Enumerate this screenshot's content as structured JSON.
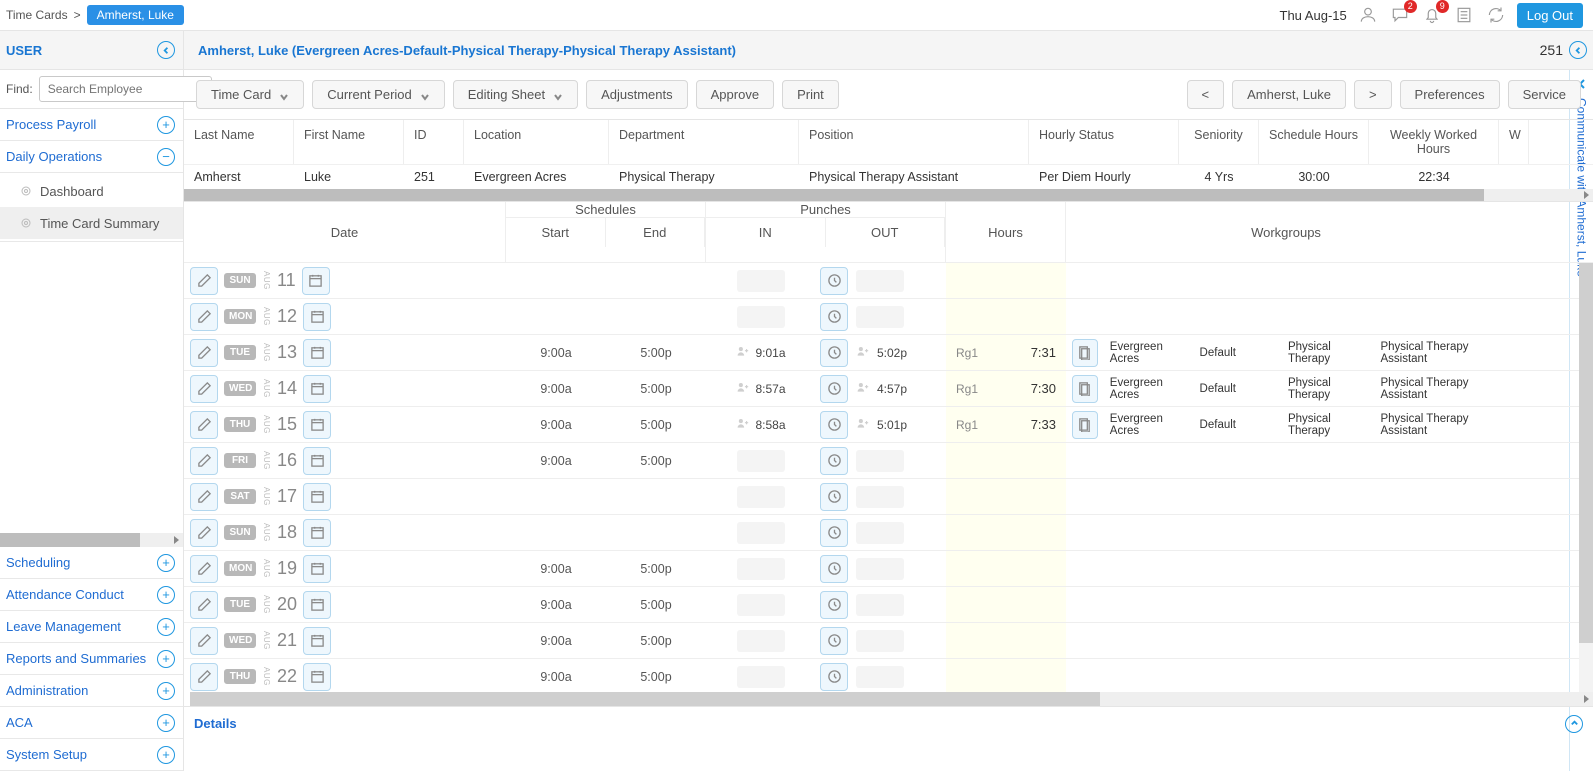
{
  "breadcrumb": {
    "root": "Time Cards",
    "chip": "Amherst, Luke"
  },
  "topright": {
    "date": "Thu Aug-15",
    "badges": {
      "chat": "2",
      "bell": "9"
    },
    "logout": "Log Out"
  },
  "headerbar": {
    "left": "USER",
    "center": "Amherst, Luke (Evergreen Acres-Default-Physical Therapy-Physical Therapy Assistant)",
    "right": "251"
  },
  "rightrail": "Communicate with Amherst, Luke",
  "sidebar": {
    "find_label": "Find:",
    "find_placeholder": "Search Employee",
    "items": [
      {
        "label": "Process Payroll",
        "type": "plus"
      },
      {
        "label": "Daily Operations",
        "type": "minus",
        "children": [
          {
            "label": "Dashboard"
          },
          {
            "label": "Time Card Summary",
            "selected": true
          }
        ]
      }
    ],
    "bottom": [
      {
        "label": "Scheduling"
      },
      {
        "label": "Attendance Conduct"
      },
      {
        "label": "Leave Management"
      },
      {
        "label": "Reports and Summaries"
      },
      {
        "label": "Administration"
      },
      {
        "label": "ACA"
      },
      {
        "label": "System Setup"
      }
    ]
  },
  "toolbar": {
    "timecard": "Time Card",
    "period": "Current Period",
    "sheet": "Editing Sheet",
    "adjustments": "Adjustments",
    "approve": "Approve",
    "print": "Print",
    "prev": "<",
    "empname": "Amherst, Luke",
    "next": ">",
    "prefs": "Preferences",
    "service": "Service"
  },
  "info": {
    "headers": [
      "Last Name",
      "First Name",
      "ID",
      "Location",
      "Department",
      "Position",
      "Hourly Status",
      "Seniority",
      "Schedule Hours",
      "Weekly Worked Hours",
      "W"
    ],
    "row": [
      "Amherst",
      "Luke",
      "251",
      "Evergreen Acres",
      "Physical Therapy",
      "Physical Therapy Assistant",
      "Per Diem Hourly",
      "4 Yrs",
      "30:00",
      "22:34",
      ""
    ]
  },
  "grid_headers": {
    "date": "Date",
    "schedules": "Schedules",
    "sched_start": "Start",
    "sched_end": "End",
    "punches": "Punches",
    "punch_in": "IN",
    "punch_out": "OUT",
    "hours": "Hours",
    "workgroups": "Workgroups"
  },
  "month_abbrev": "AUG",
  "rows": [
    {
      "dow": "SUN",
      "day": "11"
    },
    {
      "dow": "MON",
      "day": "12"
    },
    {
      "dow": "TUE",
      "day": "13",
      "start": "9:00a",
      "end": "5:00p",
      "in": "9:01a",
      "out": "5:02p",
      "rg": "Rg1",
      "hours": "7:31",
      "wg": [
        "Evergreen Acres",
        "Default",
        "Physical Therapy",
        "Physical Therapy Assistant"
      ]
    },
    {
      "dow": "WED",
      "day": "14",
      "start": "9:00a",
      "end": "5:00p",
      "in": "8:57a",
      "out": "4:57p",
      "rg": "Rg1",
      "hours": "7:30",
      "wg": [
        "Evergreen Acres",
        "Default",
        "Physical Therapy",
        "Physical Therapy Assistant"
      ]
    },
    {
      "dow": "THU",
      "day": "15",
      "start": "9:00a",
      "end": "5:00p",
      "in": "8:58a",
      "out": "5:01p",
      "rg": "Rg1",
      "hours": "7:33",
      "wg": [
        "Evergreen Acres",
        "Default",
        "Physical Therapy",
        "Physical Therapy Assistant"
      ]
    },
    {
      "dow": "FRI",
      "day": "16",
      "start": "9:00a",
      "end": "5:00p"
    },
    {
      "dow": "SAT",
      "day": "17"
    },
    {
      "dow": "SUN",
      "day": "18"
    },
    {
      "dow": "MON",
      "day": "19",
      "start": "9:00a",
      "end": "5:00p"
    },
    {
      "dow": "TUE",
      "day": "20",
      "start": "9:00a",
      "end": "5:00p"
    },
    {
      "dow": "WED",
      "day": "21",
      "start": "9:00a",
      "end": "5:00p"
    },
    {
      "dow": "THU",
      "day": "22",
      "start": "9:00a",
      "end": "5:00p"
    }
  ],
  "details": "Details"
}
